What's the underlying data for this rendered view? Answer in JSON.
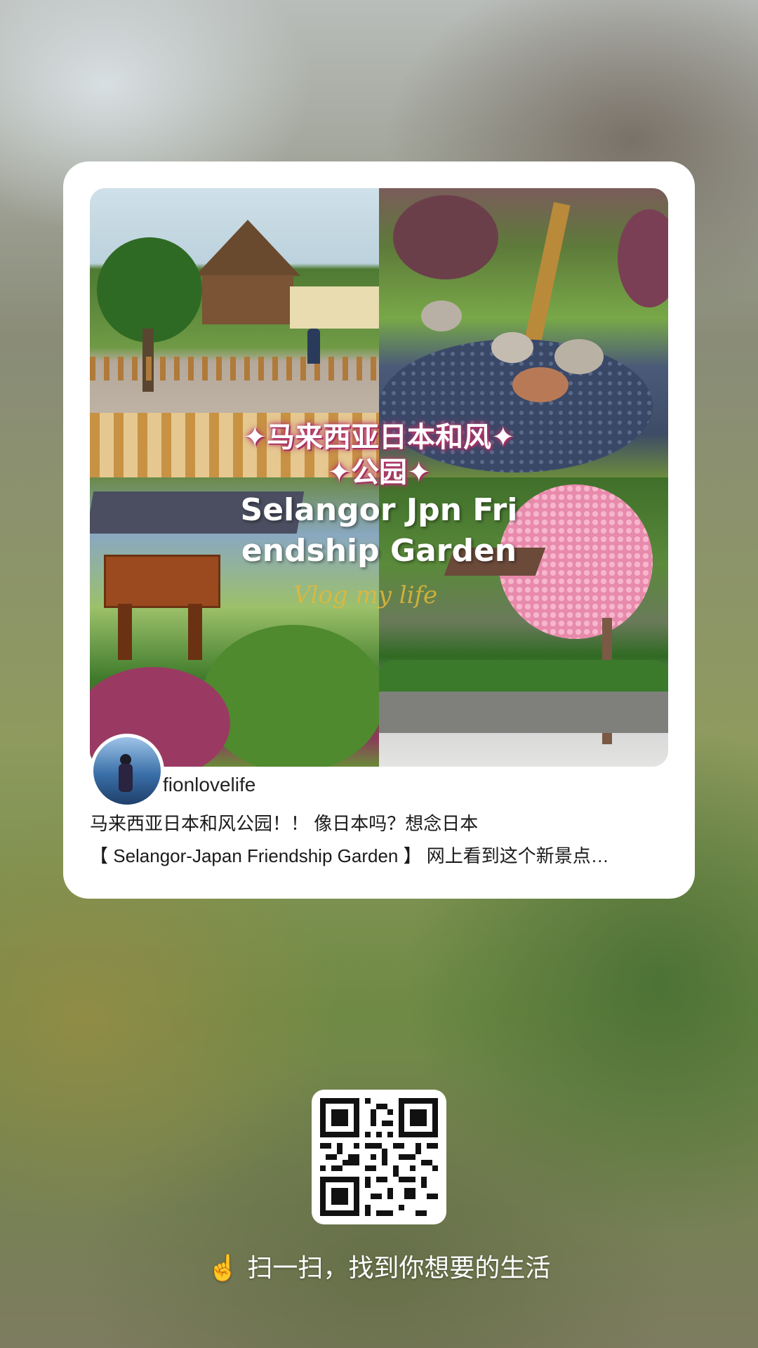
{
  "card": {
    "overlay_title_line1": "✦马来西亚日本和风✦",
    "overlay_title_line2": "✦公园✦",
    "overlay_english_line1": "Selangor Jpn Fri",
    "overlay_english_line2": "endship Garden",
    "overlay_script": "Vlog my life",
    "username": "fionlovelife",
    "description_line1": "马来西亚日本和风公园！！ 像日本吗？想念日本",
    "description_line2": "【 Selangor-Japan Friendship Garden 】 网上看到这个新景点…"
  },
  "scan_prompt": {
    "icon": "pointing-hand-icon",
    "text": "扫一扫，找到你想要的生活"
  },
  "colors": {
    "card_bg": "#ffffff",
    "title_glow": "#b2366b",
    "script_text": "#e2b83a"
  }
}
